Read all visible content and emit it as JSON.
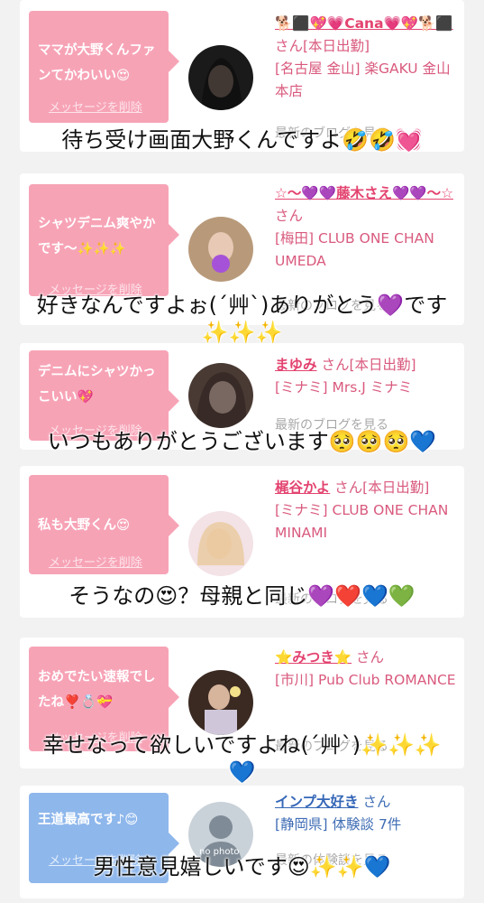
{
  "cards": [
    {
      "bubble_text": "ママが大野くんファンてかわいい😍",
      "delete_label": "メッセージを削除",
      "name": "🐕⬛💖💗Cana💗💖🐕⬛",
      "suffix": "さん[本日出勤]",
      "shop": "[名古屋 金山] 楽GAKU 金山本店",
      "blog_label": "最新のブログを見る",
      "comment": "待ち受け画面大野くんですよ🤣🤣💓"
    },
    {
      "bubble_text": "シャツデニム爽やかです〜✨✨✨",
      "delete_label": "メッセージを削除",
      "name": "☆〜💜💜藤木さえ💜💜〜☆",
      "suffix": "さん",
      "shop": "[梅田] CLUB ONE CHAN UMEDA",
      "blog_label": "最新のブログを見る",
      "comment": "好きなんですよぉ(´艸`)ありがとう💜です✨✨✨"
    },
    {
      "bubble_text": "デニムにシャツかっこいい💖",
      "delete_label": "メッセージを削除",
      "name": "まゆみ",
      "suffix": "さん[本日出勤]",
      "shop": "[ミナミ] Mrs.J ミナミ",
      "blog_label": "最新のブログを見る",
      "comment": "いつもありがとうございます🥺🥺🥺💙"
    },
    {
      "bubble_text": "私も大野くん😍",
      "delete_label": "メッセージを削除",
      "name": "梶谷かよ",
      "suffix": "さん[本日出勤]",
      "shop": "[ミナミ] CLUB ONE CHAN MINAMI",
      "blog_label": "最新のブログを見る",
      "comment": "そうなの😍？母親と同じ💜❤️💙💚"
    },
    {
      "bubble_text": "おめでたい速報でしたね❣️💍💝",
      "delete_label": "メッセージを削除",
      "name": "⭐みつき⭐",
      "suffix": "さん",
      "shop": "[市川] Pub Club ROMANCE",
      "blog_label": "最新のブログを見る",
      "comment": "幸せなって欲しいですよね(´艸`)✨✨✨💙"
    },
    {
      "bubble_text": "王道最高です♪😊",
      "delete_label": "メッセージを削除",
      "name": "インプ大好き",
      "suffix": "さん",
      "shop": "[静岡県] 体験談 7件",
      "blog_label": "最新の体験談を見る",
      "avatar_text": "no photo",
      "comment": "男性意見嬉しいです😍✨✨💙"
    }
  ],
  "colors": {
    "pink_bubble": "#f7a3b6",
    "blue_bubble": "#8eb7ec",
    "pink_text": "#e3436f",
    "blue_text": "#3567b7"
  }
}
